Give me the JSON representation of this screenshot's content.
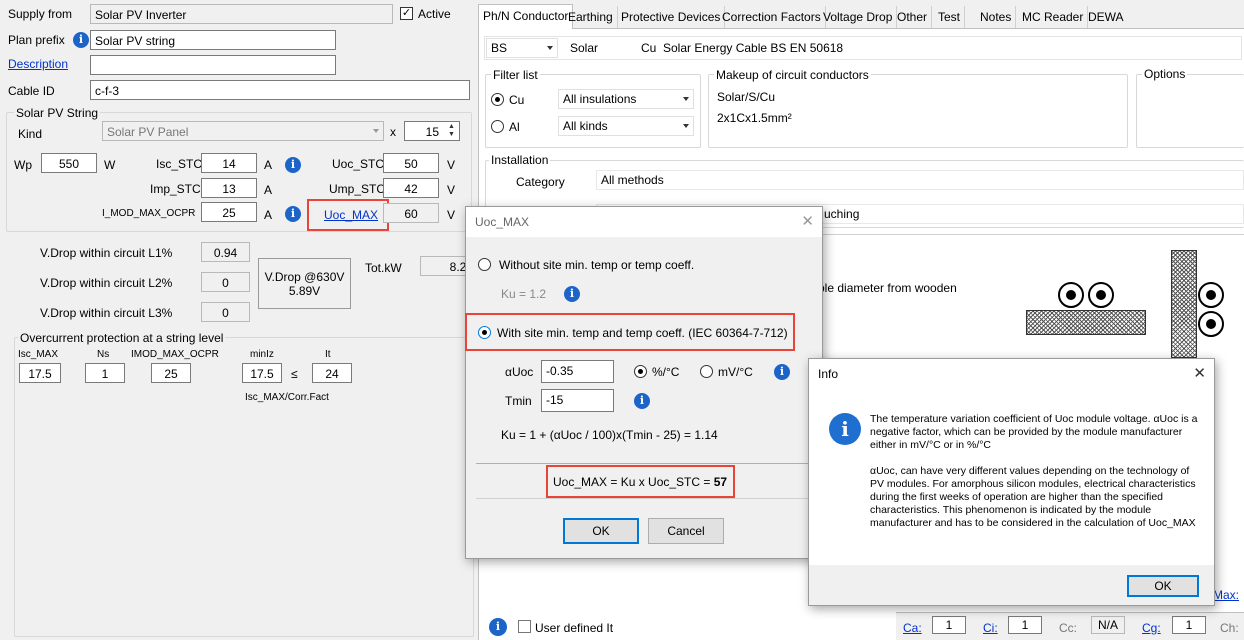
{
  "left": {
    "supply_from_label": "Supply from",
    "supply_from_value": "Solar PV Inverter",
    "active_label": "Active",
    "plan_prefix_label": "Plan prefix",
    "plan_prefix_value": "Solar PV string",
    "description_label": "Description",
    "description_value": "",
    "cable_id_label": "Cable ID",
    "cable_id_value": "c-f-3",
    "string_group": "Solar PV String",
    "kind_label": "Kind",
    "kind_value": "Solar PV Panel",
    "times": "x",
    "count_value": "15",
    "wp_label": "Wp",
    "wp_value": "550",
    "wp_unit": "W",
    "isc_stc_label": "Isc_STC",
    "isc_stc_value": "14",
    "amp_unit": "A",
    "uoc_stc_label": "Uoc_STC",
    "uoc_stc_value": "50",
    "volt_unit": "V",
    "imp_stc_label": "Imp_STC",
    "imp_stc_value": "13",
    "ump_stc_label": "Ump_STC",
    "ump_stc_value": "42",
    "imod_label": "I_MOD_MAX_OCPR",
    "imod_value": "25",
    "uoc_max_link": "Uoc_MAX",
    "uoc_max_value": "60",
    "vdrop_l1_label": "V.Drop within circuit L1%",
    "vdrop_l1_value": "0.94",
    "vdrop_l2_label": "V.Drop within circuit L2%",
    "vdrop_l2_value": "0",
    "vdrop_l3_label": "V.Drop within circuit L3%",
    "vdrop_l3_value": "0",
    "vdrop_at_label": "V.Drop @630V",
    "vdrop_at_value": "5.89V",
    "totkw_label": "Tot.kW",
    "totkw_value": "8.25",
    "ocp_group": "Overcurrent protection at a string level",
    "ocp_isc_max_label": "Isc_MAX",
    "ocp_isc_max_value": "17.5",
    "ocp_ns_label": "Ns",
    "ocp_ns_value": "1",
    "ocp_imod_label": "IMOD_MAX_OCPR",
    "ocp_imod_value": "25",
    "ocp_minlz_label": "minIz",
    "ocp_minlz_value": "17.5",
    "ocp_leq": "≤",
    "ocp_it_label": "It",
    "ocp_it_value": "24",
    "ocp_note": "Isc_MAX/Corr.Fact"
  },
  "tabs": [
    "Ph/N Conductor",
    "Earthing",
    "Protective Devices",
    "Correction Factors",
    "Voltage Drop",
    "Other",
    "Test",
    "Notes",
    "MC Reader",
    "DEWA"
  ],
  "right": {
    "std_value": "BS",
    "type_value": "Solar",
    "material_value": "Cu",
    "cable_name": "Solar Energy Cable BS EN 50618",
    "filter_group": "Filter list",
    "radio_cu": "Cu",
    "radio_al": "Al",
    "insulation_value": "All insulations",
    "kinds_value": "All kinds",
    "makeup_group": "Makeup of circuit conductors",
    "makeup_line1": "Solar/S/Cu",
    "makeup_line2": "2x1Cx1.5mm²",
    "options_group": "Options",
    "installation_group": "Installation",
    "category_label": "Category",
    "category_value": "All methods",
    "method_fragment": "uching",
    "install_desc_fragment": "ble diameter from wooden",
    "user_defined_label": "User defined It",
    "ca_label": "Ca:",
    "ca_value": "1",
    "ci_label": "Ci:",
    "ci_value": "1",
    "cc_label": "Cc:",
    "cc_value": "N/A",
    "cg_label": "Cg:",
    "cg_value": "1",
    "ch_label": "Ch:",
    "max_fragment": "Max:"
  },
  "uoc_dialog": {
    "title": "Uoc_MAX",
    "opt1_label": "Without site min. temp or temp coeff.",
    "ku_label": "Ku = 1.2",
    "opt2_label": "With site min. temp and temp coeff. (IEC 60364-7-712)",
    "auoc_label": "αUoc",
    "auoc_value": "-0.35",
    "unit_pct": "%/°C",
    "unit_mv": "mV/°C",
    "tmin_label": "Tmin",
    "tmin_value": "-15",
    "ku_formula": "Ku = 1 + (αUoc / 100)x(Tmin  - 25) =  1.14",
    "result_text": "Uoc_MAX = Ku x Uoc_STC  =",
    "result_value": "57",
    "ok_label": "OK",
    "cancel_label": "Cancel"
  },
  "info_dialog": {
    "title": "Info",
    "para1": "The temperature variation coefficient of Uoc module voltage. αUoc is a negative factor, which can be provided by the module manufacturer either in mV/°C or in %/°C",
    "para2": "αUoc, can have very different values depending on the technology of PV modules. For amorphous silicon modules, electrical characteristics during the first weeks of operation are higher than the specified characteristics. This phenomenon is indicated by the module manufacturer and has to be considered in the calculation of Uoc_MAX",
    "ok_label": "OK"
  },
  "colors": {
    "highlight": "#e8443a",
    "info_blue": "#1d64c8",
    "link": "#0033cc"
  }
}
